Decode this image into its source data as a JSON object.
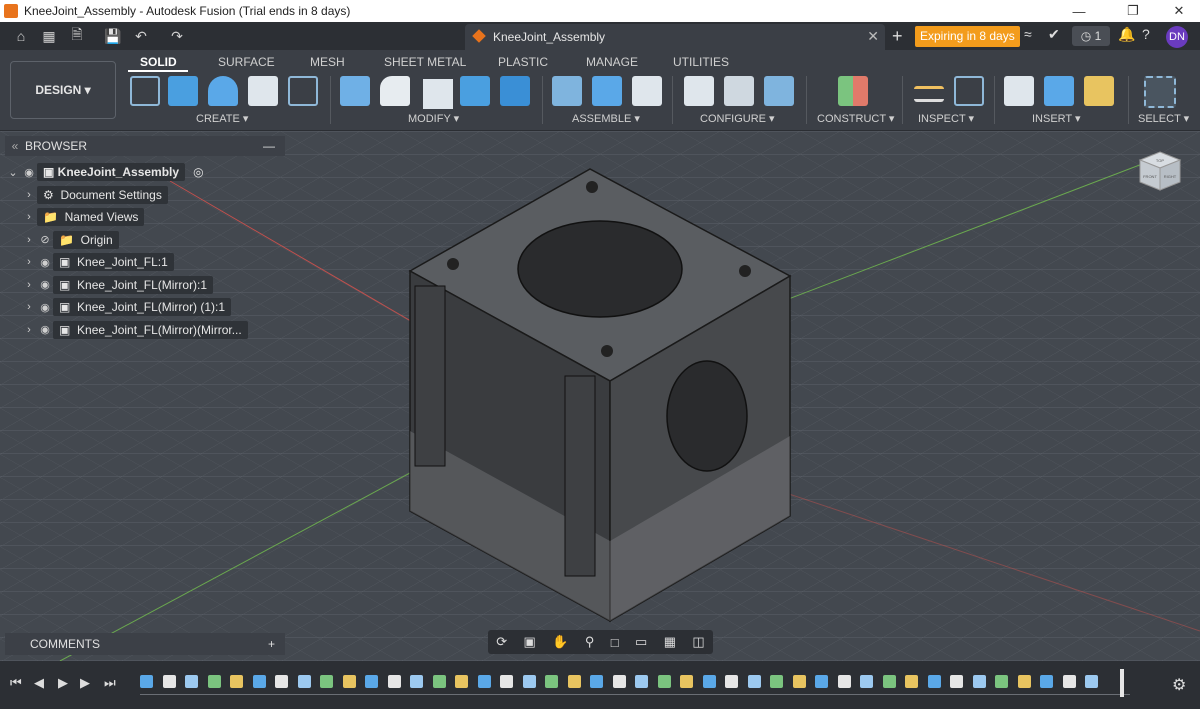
{
  "window": {
    "title": "KneeJoint_Assembly - Autodesk Fusion (Trial ends in 8 days)",
    "minimize_icon": "minimize-icon",
    "restore_icon": "restore-icon",
    "close_icon": "close-icon"
  },
  "appbar": {
    "document_tab": "KneeJoint_Assembly",
    "expiring_badge": "Expiring in 8 days",
    "notifications_count": "1",
    "user_initials": "DN",
    "accent_color": "#f39c1c",
    "avatar_color": "#6a3bbf"
  },
  "toolbar": {
    "workspace": "DESIGN",
    "tabs": [
      "SOLID",
      "SURFACE",
      "MESH",
      "SHEET METAL",
      "PLASTIC",
      "MANAGE",
      "UTILITIES"
    ],
    "active_tab": "SOLID",
    "groups": [
      "CREATE",
      "MODIFY",
      "ASSEMBLE",
      "CONFIGURE",
      "CONSTRUCT",
      "INSPECT",
      "INSERT",
      "SELECT"
    ]
  },
  "browser": {
    "title": "BROWSER",
    "root": "KneeJoint_Assembly",
    "items": [
      "Document Settings",
      "Named Views",
      "Origin",
      "Knee_Joint_FL:1",
      "Knee_Joint_FL(Mirror):1",
      "Knee_Joint_FL(Mirror) (1):1",
      "Knee_Joint_FL(Mirror)(Mirror..."
    ]
  },
  "comments": {
    "title": "COMMENTS"
  },
  "viewcube": {
    "faces": [
      "TOP",
      "FRONT",
      "RIGHT"
    ]
  }
}
